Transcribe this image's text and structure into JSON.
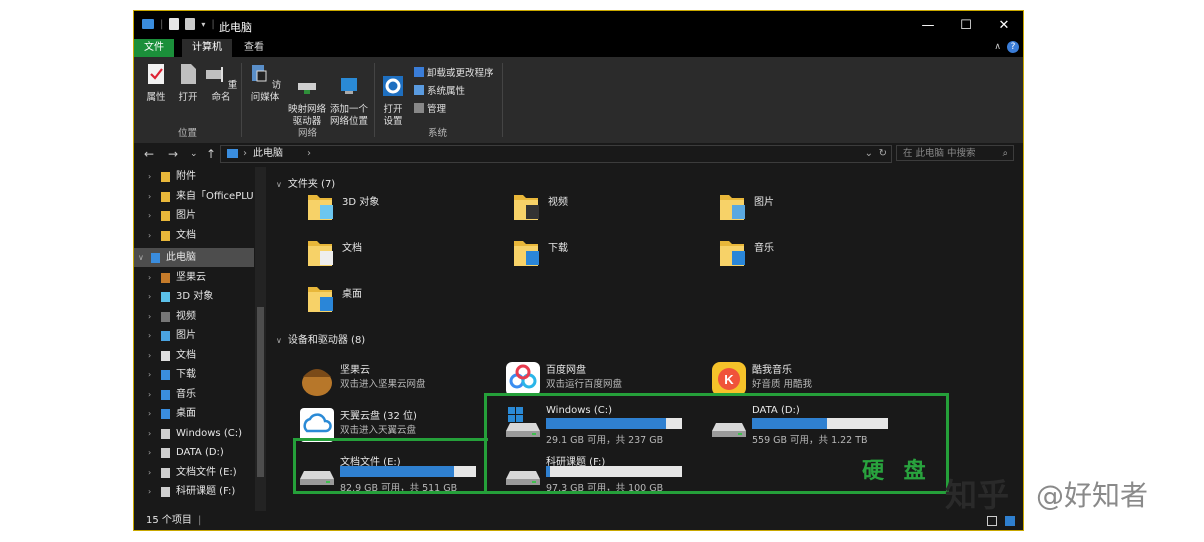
{
  "window": {
    "title": "此电脑"
  },
  "ribbon_tabs": [
    "文件",
    "计算机",
    "查看"
  ],
  "ribbon": {
    "buttons": [
      {
        "label": "属性"
      },
      {
        "label": "打开"
      },
      {
        "label": "重命名"
      },
      {
        "label": "访问媒体"
      },
      {
        "label": "映射网络\n驱动器"
      },
      {
        "label": "添加一个\n网络位置"
      },
      {
        "label": "打开\n设置"
      }
    ],
    "system_links": [
      "卸载或更改程序",
      "系统属性",
      "管理"
    ],
    "groups": [
      "位置",
      "网络",
      "系统"
    ],
    "colors": {
      "file_tab": "#1b8f3a",
      "accent": "#2f80d0"
    }
  },
  "address": {
    "path": "此电脑",
    "search_placeholder": "在 此电脑 中搜索"
  },
  "nav": [
    {
      "label": "附件",
      "icon": "folder-icon"
    },
    {
      "label": "来自「OfficePLU",
      "icon": "folder-icon"
    },
    {
      "label": "图片",
      "icon": "folder-icon"
    },
    {
      "label": "文档",
      "icon": "folder-icon"
    },
    {
      "label": "此电脑",
      "icon": "computer-icon",
      "selected": true
    },
    {
      "label": "坚果云",
      "icon": "nut-icon"
    },
    {
      "label": "3D 对象",
      "icon": "cube-icon"
    },
    {
      "label": "视频",
      "icon": "video-icon"
    },
    {
      "label": "图片",
      "icon": "picture-icon"
    },
    {
      "label": "文档",
      "icon": "document-icon"
    },
    {
      "label": "下载",
      "icon": "download-icon"
    },
    {
      "label": "音乐",
      "icon": "music-icon"
    },
    {
      "label": "桌面",
      "icon": "desktop-icon"
    },
    {
      "label": "Windows (C:)",
      "icon": "drive-icon"
    },
    {
      "label": "DATA (D:)",
      "icon": "drive-icon"
    },
    {
      "label": "文档文件 (E:)",
      "icon": "drive-icon"
    },
    {
      "label": "科研课题 (F:)",
      "icon": "drive-icon"
    }
  ],
  "folders_header": "文件夹 (7)",
  "folders": [
    "3D 对象",
    "视频",
    "图片",
    "文档",
    "下载",
    "音乐",
    "桌面"
  ],
  "devices_header": "设备和驱动器 (8)",
  "apps": [
    {
      "name": "坚果云",
      "desc": "双击进入坚果云网盘"
    },
    {
      "name": "百度网盘",
      "desc": "双击运行百度网盘"
    },
    {
      "name": "酷我音乐",
      "desc": "好音质 用酷我"
    },
    {
      "name": "天翼云盘 (32 位)",
      "desc": "双击进入天翼云盘"
    }
  ],
  "drives": [
    {
      "name": "Windows (C:)",
      "free": "29.1 GB 可用，共 237 GB",
      "used_fraction": 0.88
    },
    {
      "name": "DATA (D:)",
      "free": "559 GB 可用，共 1.22 TB",
      "used_fraction": 0.55
    },
    {
      "name": "文档文件 (E:)",
      "free": "82.9 GB 可用，共 511 GB",
      "used_fraction": 0.84
    },
    {
      "name": "科研课题 (F:)",
      "free": "97.3 GB 可用，共 100 GB",
      "used_fraction": 0.03
    }
  ],
  "status": {
    "count": "15 个项目"
  },
  "annotation": {
    "label": "硬 盘",
    "color": "#25a03a"
  },
  "watermark": {
    "left": "知乎",
    "right": "@好知者"
  }
}
